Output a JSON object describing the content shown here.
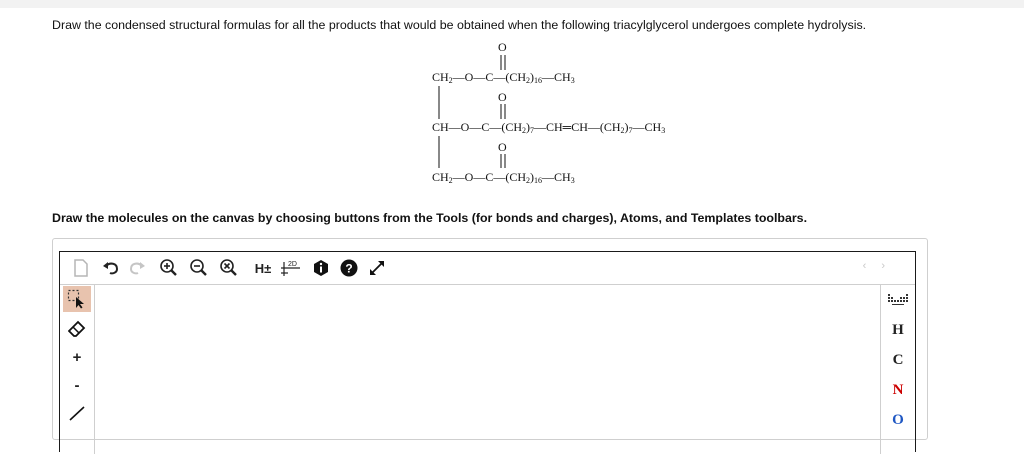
{
  "question": {
    "prompt": "Draw the condensed structural formulas for all the products that would be obtained when the following triacylglycerol undergoes complete hydrolysis.",
    "instructions": "Draw the molecules on the canvas by choosing buttons from the Tools (for bonds and charges), Atoms, and Templates toolbars."
  },
  "structure": {
    "o_label": "O",
    "row1_prefix": "CH",
    "row1_sub": "2",
    "row1_mid": "—O—C—(CH",
    "row1_sub2": "2",
    "row1_count": ")",
    "row1_n": "16",
    "row1_end": "—CH",
    "row1_end_sub": "3",
    "row2_prefix": "CH—O—C—(CH",
    "row2_sub": "2",
    "row2_close": ")",
    "row2_n": "7",
    "row2_mid": "—CH═CH—(CH",
    "row2_sub2": "2",
    "row2_close2": ")",
    "row2_n2": "7",
    "row2_end": "—CH",
    "row2_end_sub": "3"
  },
  "editor": {
    "toolbar_top": {
      "h_toggle": "H±",
      "clean_label": "2D",
      "nav": "‹ ›"
    },
    "atoms": [
      "H",
      "C",
      "N",
      "O"
    ],
    "atom_colors": {
      "H": "#222222",
      "C": "#222222",
      "N": "#cc0000",
      "O": "#1f57c3"
    },
    "left_tools": {
      "plus": "+",
      "minus": "-"
    }
  }
}
